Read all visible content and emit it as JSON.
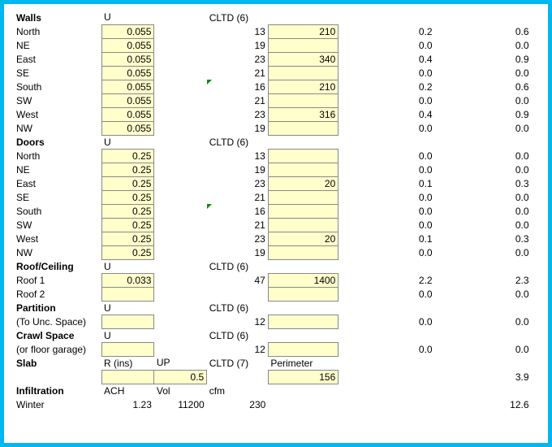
{
  "sections": {
    "walls": {
      "title": "Walls",
      "u_hdr": "U",
      "cltd_hdr": "CLTD (6)"
    },
    "doors": {
      "title": "Doors",
      "u_hdr": "U",
      "cltd_hdr": "CLTD (6)"
    },
    "roof": {
      "title": "Roof/Ceiling",
      "u_hdr": "U",
      "cltd_hdr": "CLTD (6)"
    },
    "partition": {
      "title": "Partition",
      "sub": "(To Unc. Space)",
      "u_hdr": "U",
      "cltd_hdr": "CLTD (6)"
    },
    "crawl": {
      "title": "Crawl Space",
      "sub": "(or floor garage)",
      "u_hdr": "U",
      "cltd_hdr": "CLTD (6)"
    },
    "slab": {
      "title": "Slab",
      "r_hdr": "R (ins)",
      "up_hdr": "UP",
      "cltd_hdr": "CLTD (7)",
      "perim_hdr": "Perimeter"
    },
    "infil": {
      "title": "Infiltration",
      "ach_hdr": "ACH",
      "vol_hdr": "Vol",
      "cfm_hdr": "cfm"
    }
  },
  "walls": [
    {
      "dir": "North",
      "u": "0.055",
      "cltd": "13",
      "area": "210",
      "v1": "0.2",
      "v2": "0.6"
    },
    {
      "dir": "NE",
      "u": "0.055",
      "cltd": "19",
      "area": "",
      "v1": "0.0",
      "v2": "0.0"
    },
    {
      "dir": "East",
      "u": "0.055",
      "cltd": "23",
      "area": "340",
      "v1": "0.4",
      "v2": "0.9"
    },
    {
      "dir": "SE",
      "u": "0.055",
      "cltd": "21",
      "area": "",
      "v1": "0.0",
      "v2": "0.0"
    },
    {
      "dir": "South",
      "u": "0.055",
      "cltd": "16",
      "area": "210",
      "v1": "0.2",
      "v2": "0.6",
      "tri": true
    },
    {
      "dir": "SW",
      "u": "0.055",
      "cltd": "21",
      "area": "",
      "v1": "0.0",
      "v2": "0.0"
    },
    {
      "dir": "West",
      "u": "0.055",
      "cltd": "23",
      "area": "316",
      "v1": "0.4",
      "v2": "0.9"
    },
    {
      "dir": "NW",
      "u": "0.055",
      "cltd": "19",
      "area": "",
      "v1": "0.0",
      "v2": "0.0"
    }
  ],
  "doors": [
    {
      "dir": "North",
      "u": "0.25",
      "cltd": "13",
      "area": "",
      "v1": "0.0",
      "v2": "0.0"
    },
    {
      "dir": "NE",
      "u": "0.25",
      "cltd": "19",
      "area": "",
      "v1": "0.0",
      "v2": "0.0"
    },
    {
      "dir": "East",
      "u": "0.25",
      "cltd": "23",
      "area": "20",
      "v1": "0.1",
      "v2": "0.3"
    },
    {
      "dir": "SE",
      "u": "0.25",
      "cltd": "21",
      "area": "",
      "v1": "0.0",
      "v2": "0.0"
    },
    {
      "dir": "South",
      "u": "0.25",
      "cltd": "16",
      "area": "",
      "v1": "0.0",
      "v2": "0.0",
      "tri": true
    },
    {
      "dir": "SW",
      "u": "0.25",
      "cltd": "21",
      "area": "",
      "v1": "0.0",
      "v2": "0.0"
    },
    {
      "dir": "West",
      "u": "0.25",
      "cltd": "23",
      "area": "20",
      "v1": "0.1",
      "v2": "0.3"
    },
    {
      "dir": "NW",
      "u": "0.25",
      "cltd": "19",
      "area": "",
      "v1": "0.0",
      "v2": "0.0"
    }
  ],
  "roof": [
    {
      "dir": "Roof 1",
      "u": "0.033",
      "cltd": "47",
      "area": "1400",
      "v1": "2.2",
      "v2": "2.3"
    },
    {
      "dir": "Roof 2",
      "u": "",
      "cltd": "",
      "area": "",
      "v1": "0.0",
      "v2": "0.0"
    }
  ],
  "partition_row": {
    "u": "",
    "cltd": "12",
    "area": "",
    "v1": "0.0",
    "v2": "0.0"
  },
  "crawl_row": {
    "u": "",
    "cltd": "12",
    "area": "",
    "v1": "0.0",
    "v2": "0.0"
  },
  "slab_row": {
    "r": "",
    "up": "0.5",
    "cltd": "",
    "perim": "156",
    "v1": "",
    "v2": "3.9"
  },
  "infil_row": {
    "label": "Winter",
    "ach": "1.23",
    "vol": "11200",
    "cfm": "230",
    "v1": "",
    "v2": "12.6"
  }
}
